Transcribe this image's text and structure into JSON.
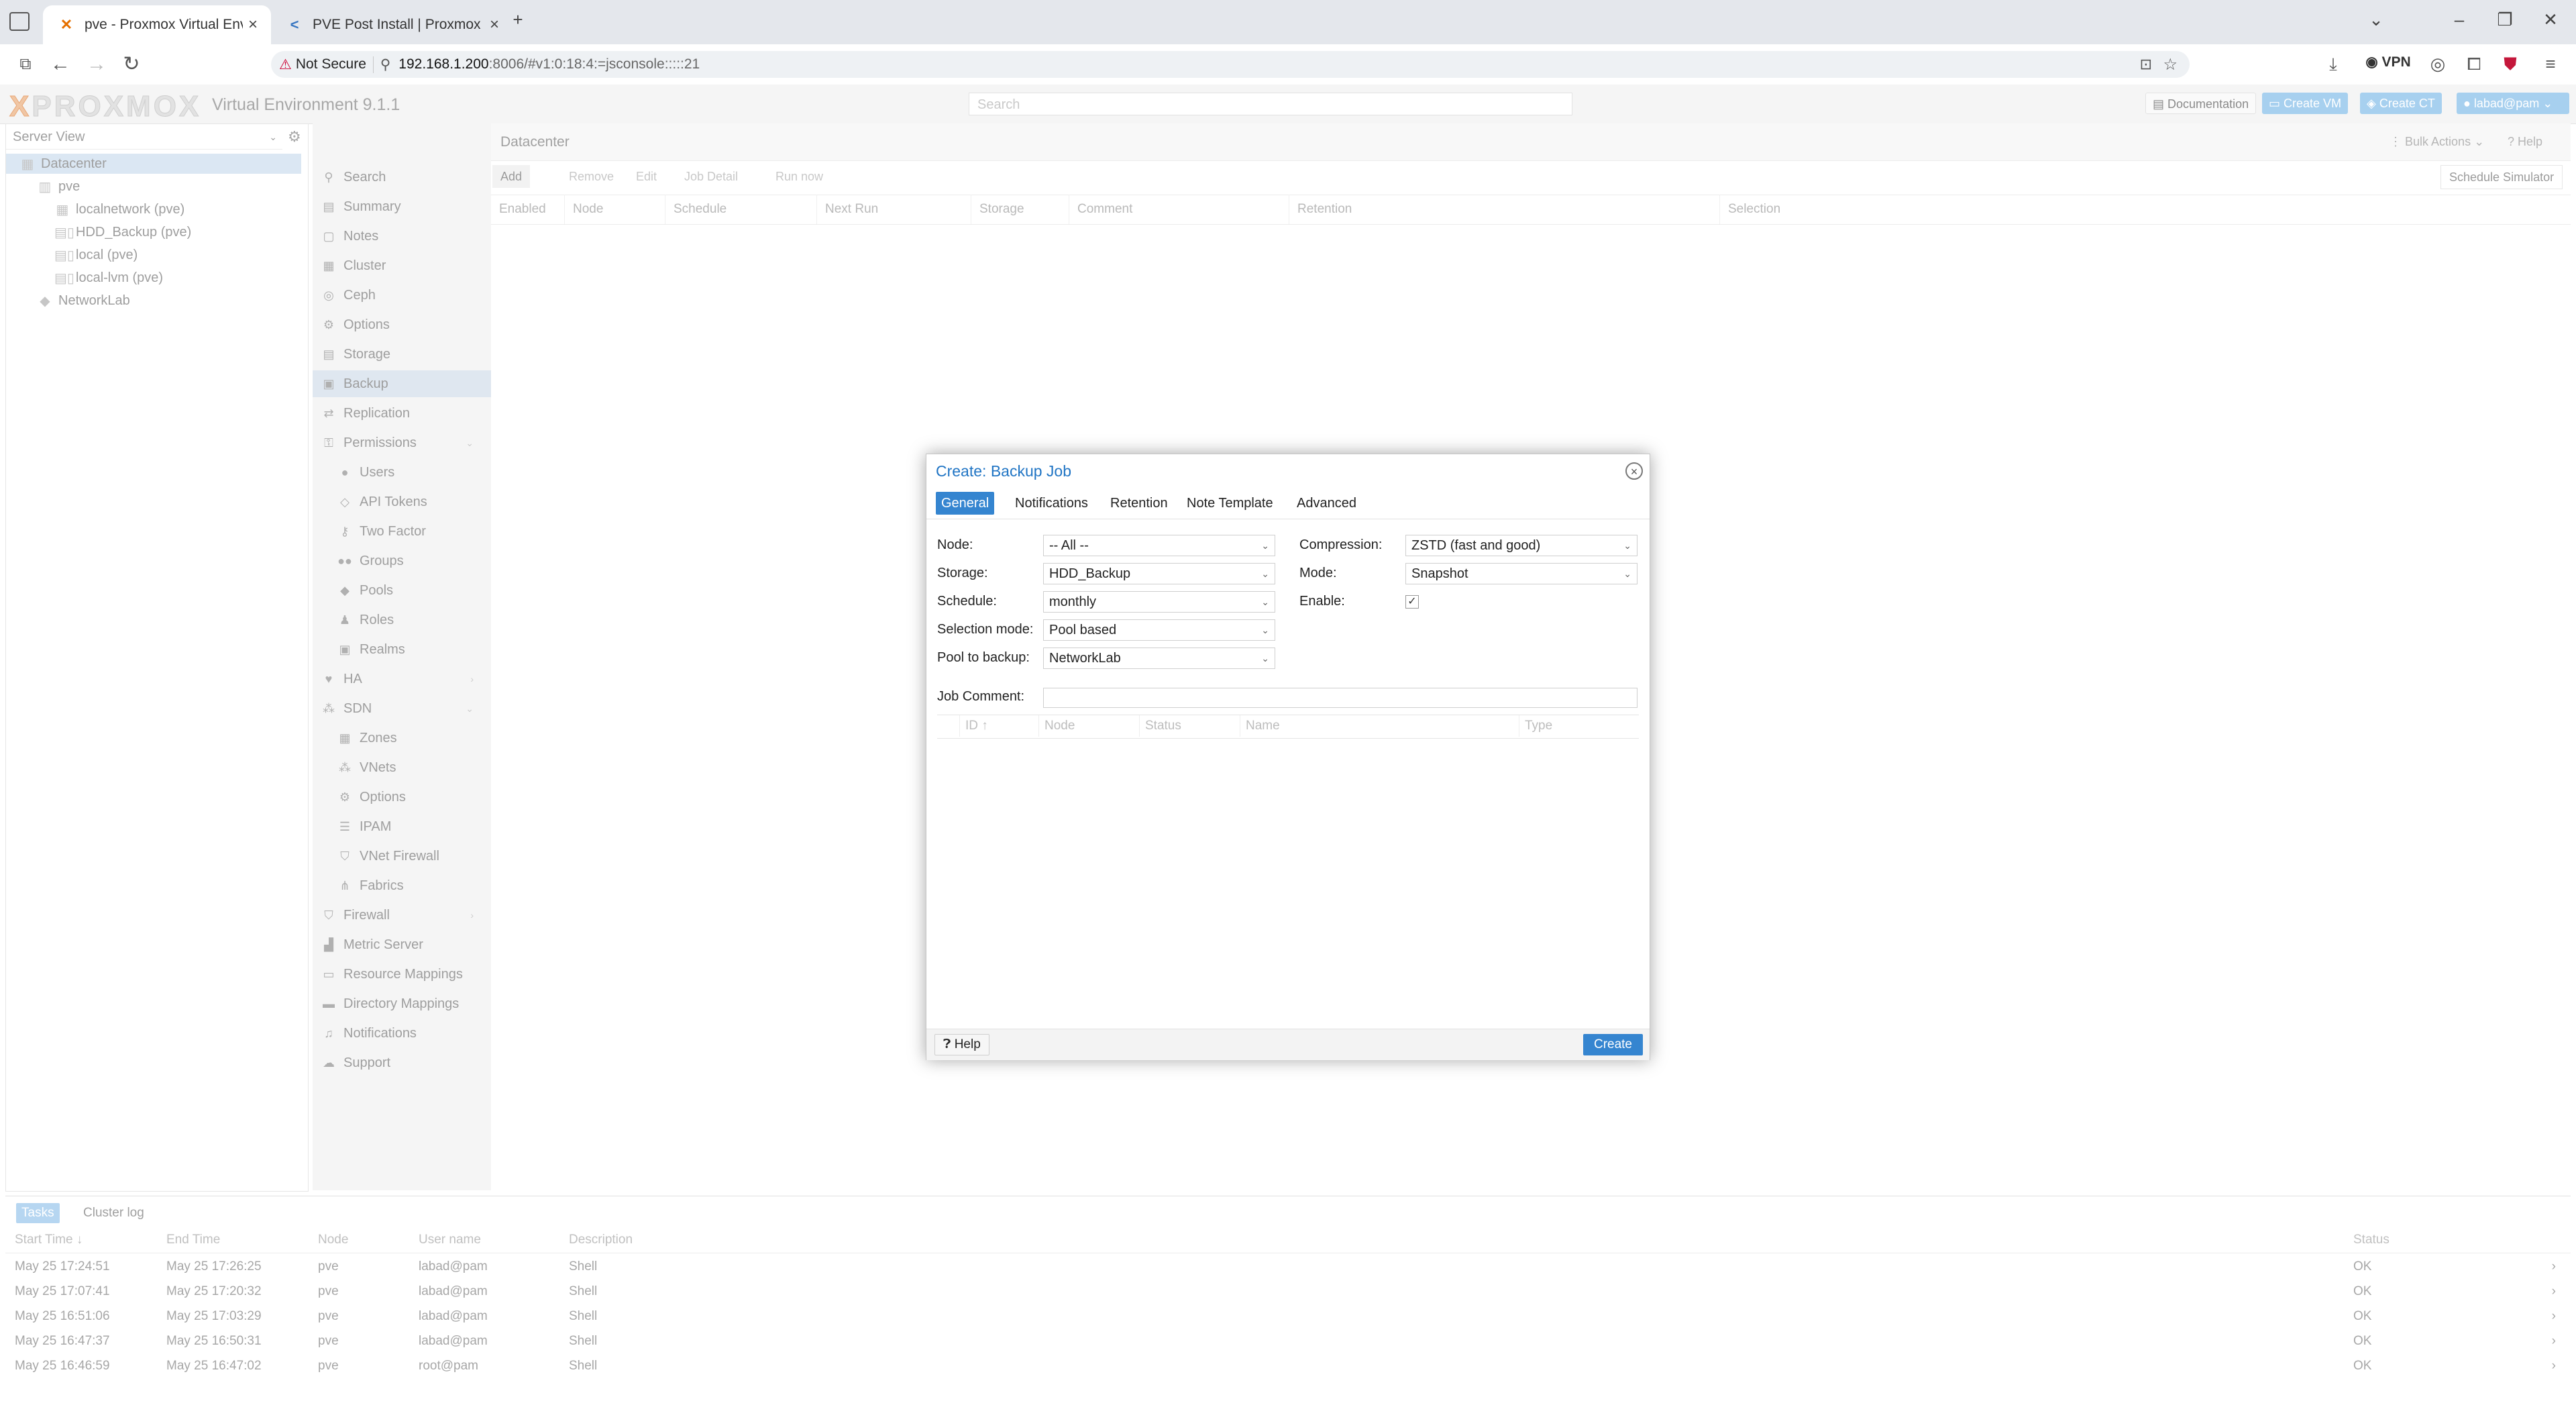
{
  "browser": {
    "tabs": [
      {
        "title": "pve - Proxmox Virtual Environm",
        "active": true
      },
      {
        "title": "PVE Post Install | Proxmox VE H",
        "active": false
      }
    ],
    "not_secure": "Not Secure",
    "url_host": "192.168.1.200",
    "url_rest": ":8006/#v1:0:18:4:=jsconsole:::::21",
    "vpn_label": "VPN"
  },
  "header": {
    "logo": "PROXMOX",
    "version": "Virtual Environment 9.1.1",
    "search_placeholder": "Search",
    "documentation": "Documentation",
    "create_vm": "Create VM",
    "create_ct": "Create CT",
    "user": "labad@pam"
  },
  "tree": {
    "view_label": "Server View",
    "nodes": [
      {
        "label": "Datacenter",
        "icon": "datacenter-icon"
      },
      {
        "label": "pve",
        "icon": "node-icon"
      },
      {
        "label": "localnetwork (pve)",
        "icon": "network-icon"
      },
      {
        "label": "HDD_Backup (pve)",
        "icon": "storage-icon"
      },
      {
        "label": "local (pve)",
        "icon": "storage-icon"
      },
      {
        "label": "local-lvm (pve)",
        "icon": "storage-icon"
      },
      {
        "label": "NetworkLab",
        "icon": "pool-icon"
      }
    ]
  },
  "menu": {
    "items": [
      {
        "label": "Search",
        "icon": "search-icon"
      },
      {
        "label": "Summary",
        "icon": "summary-icon"
      },
      {
        "label": "Notes",
        "icon": "notes-icon"
      },
      {
        "label": "Cluster",
        "icon": "cluster-icon"
      },
      {
        "label": "Ceph",
        "icon": "ceph-icon"
      },
      {
        "label": "Options",
        "icon": "gear-icon"
      },
      {
        "label": "Storage",
        "icon": "storage-icon"
      },
      {
        "label": "Backup",
        "icon": "backup-icon"
      },
      {
        "label": "Replication",
        "icon": "replication-icon"
      },
      {
        "label": "Permissions",
        "icon": "permissions-icon"
      },
      {
        "label": "Users",
        "icon": "user-icon"
      },
      {
        "label": "API Tokens",
        "icon": "token-icon"
      },
      {
        "label": "Two Factor",
        "icon": "key-icon"
      },
      {
        "label": "Groups",
        "icon": "group-icon"
      },
      {
        "label": "Pools",
        "icon": "pool-icon"
      },
      {
        "label": "Roles",
        "icon": "role-icon"
      },
      {
        "label": "Realms",
        "icon": "realm-icon"
      },
      {
        "label": "HA",
        "icon": "heart-icon"
      },
      {
        "label": "SDN",
        "icon": "sdn-icon"
      },
      {
        "label": "Zones",
        "icon": "zones-icon"
      },
      {
        "label": "VNets",
        "icon": "vnets-icon"
      },
      {
        "label": "Options",
        "icon": "gear-icon"
      },
      {
        "label": "IPAM",
        "icon": "ipam-icon"
      },
      {
        "label": "VNet Firewall",
        "icon": "shield-icon"
      },
      {
        "label": "Fabrics",
        "icon": "fabrics-icon"
      },
      {
        "label": "Firewall",
        "icon": "shield-icon"
      },
      {
        "label": "Metric Server",
        "icon": "chart-icon"
      },
      {
        "label": "Resource Mappings",
        "icon": "folder-icon"
      },
      {
        "label": "Directory Mappings",
        "icon": "folder-icon"
      },
      {
        "label": "Notifications",
        "icon": "bell-icon"
      },
      {
        "label": "Support",
        "icon": "support-icon"
      }
    ]
  },
  "content": {
    "breadcrumb": "Datacenter",
    "bulk_actions": "Bulk Actions",
    "help": "Help",
    "toolbar": [
      "Add",
      "Remove",
      "Edit",
      "Job Detail",
      "Run now"
    ],
    "schedule_simulator": "Schedule Simulator",
    "columns": [
      "Enabled",
      "Node",
      "Schedule",
      "Next Run",
      "Storage",
      "Comment",
      "Retention",
      "Selection"
    ]
  },
  "dialog": {
    "title": "Create: Backup Job",
    "tabs": [
      "General",
      "Notifications",
      "Retention",
      "Note Template",
      "Advanced"
    ],
    "fields": {
      "node_label": "Node:",
      "node_value": "-- All --",
      "storage_label": "Storage:",
      "storage_value": "HDD_Backup",
      "schedule_label": "Schedule:",
      "schedule_value": "monthly",
      "selection_label": "Selection mode:",
      "selection_value": "Pool based",
      "pool_label": "Pool to backup:",
      "pool_value": "NetworkLab",
      "compression_label": "Compression:",
      "compression_value": "ZSTD (fast and good)",
      "mode_label": "Mode:",
      "mode_value": "Snapshot",
      "enable_label": "Enable:",
      "enable_checked": true,
      "comment_label": "Job Comment:",
      "comment_value": ""
    },
    "grid_columns": [
      "ID ↑",
      "Node",
      "Status",
      "Name",
      "Type"
    ],
    "help": "Help",
    "create": "Create"
  },
  "tasks": {
    "tabs": [
      "Tasks",
      "Cluster log"
    ],
    "columns": [
      "Start Time ↓",
      "End Time",
      "Node",
      "User name",
      "Description",
      "Status"
    ],
    "rows": [
      [
        "May 25 17:24:51",
        "May 25 17:26:25",
        "pve",
        "labad@pam",
        "Shell",
        "OK"
      ],
      [
        "May 25 17:07:41",
        "May 25 17:20:32",
        "pve",
        "labad@pam",
        "Shell",
        "OK"
      ],
      [
        "May 25 16:51:06",
        "May 25 17:03:29",
        "pve",
        "labad@pam",
        "Shell",
        "OK"
      ],
      [
        "May 25 16:47:37",
        "May 25 16:50:31",
        "pve",
        "labad@pam",
        "Shell",
        "OK"
      ],
      [
        "May 25 16:46:59",
        "May 25 16:47:02",
        "pve",
        "root@pam",
        "Shell",
        "OK"
      ]
    ]
  },
  "colors": {
    "accent": "#3585d0",
    "title_blue": "#1f74c4",
    "selection": "#dfe7f0"
  }
}
